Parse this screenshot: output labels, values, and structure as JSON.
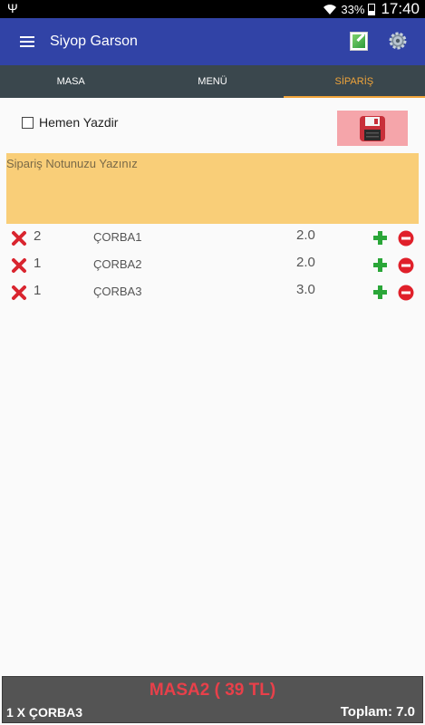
{
  "status_bar": {
    "battery": "33%",
    "time": "17:40"
  },
  "app_bar": {
    "title": "Siyop Garson"
  },
  "tabs": [
    {
      "label": "MASA",
      "active": false
    },
    {
      "label": "MENÜ",
      "active": false
    },
    {
      "label": "SİPARİŞ",
      "active": true
    }
  ],
  "print_option": {
    "label": "Hemen Yazdir",
    "checked": false
  },
  "note": {
    "placeholder": "Sipariş Notunuzu Yazınız"
  },
  "orders": [
    {
      "qty": "2",
      "name": "ÇORBA1",
      "price": "2.0"
    },
    {
      "qty": "1",
      "name": "ÇORBA2",
      "price": "2.0"
    },
    {
      "qty": "1",
      "name": "ÇORBA3",
      "price": "3.0"
    }
  ],
  "footer": {
    "table": "MASA2 ( 39 TL)",
    "last_item": "1 X ÇORBA3",
    "total": "Toplam: 7.0"
  },
  "colors": {
    "app_bar": "#3143a6",
    "tab_bar": "#3a474d",
    "tab_active": "#f0a43a",
    "note_bg": "#f9ce78",
    "save_bg": "#f5a5aa",
    "footer_table": "#e8404a"
  }
}
